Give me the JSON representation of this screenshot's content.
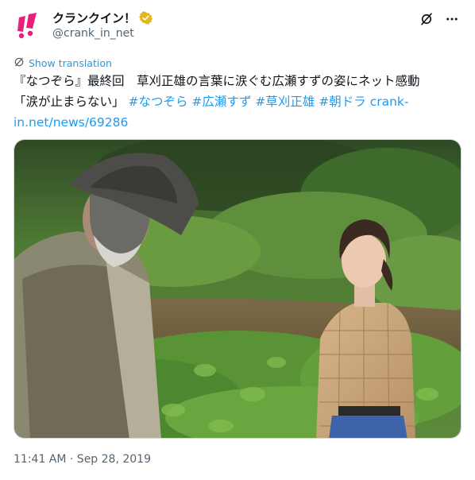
{
  "author": {
    "display_name": "クランクイン！",
    "handle": "@crank_in_net",
    "avatar_icon": "crank-in-logo-icon",
    "verified_icon": "gold-verified-badge-icon",
    "brand_color": "#e8207c"
  },
  "actions": {
    "grok_icon": "grok-icon",
    "more_icon": "more-options-icon"
  },
  "translation": {
    "icon": "translate-icon",
    "label": "Show translation"
  },
  "tweet": {
    "line1": "『なつぞら』最終回　草刈正雄の言葉に涙ぐむ広瀬すずの姿にネット感動",
    "line2_text": "「涙が止まらない」",
    "hashtags": [
      "#なつぞら",
      "#広瀬すず",
      "#草刈正雄",
      "#朝ドラ"
    ],
    "link_part1": "crank-",
    "link_part2": "in.net/news/69286"
  },
  "media": {
    "type": "photo",
    "icon": "photo-image"
  },
  "timestamp": "11:41 AM · Sep 28, 2019",
  "colors": {
    "link": "#1d9bf0",
    "secondary_text": "#536471",
    "verified_gold": "#e2b719"
  }
}
